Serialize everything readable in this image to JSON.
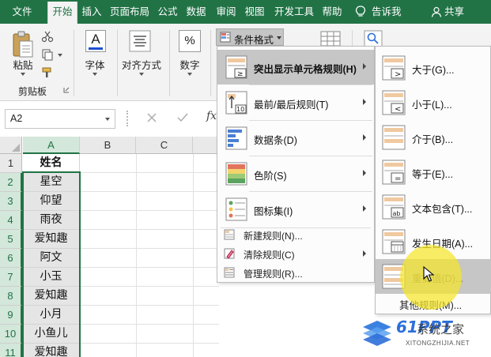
{
  "colors": {
    "tabbar": "#217346",
    "selection": "#217346",
    "menu_hover": "#c6c6c6",
    "spotlight": "#f5e628"
  },
  "tabs": [
    "文件",
    "开始",
    "插入",
    "页面布局",
    "公式",
    "数据",
    "审阅",
    "视图",
    "开发工具",
    "帮助",
    "告诉我",
    "共享"
  ],
  "active_tab": "开始",
  "ribbon": {
    "paste_label": "粘贴",
    "clipboard_group": "剪贴板",
    "font_label": "字体",
    "align_label": "对齐方式",
    "number_label": "数字",
    "number_icon": "%",
    "font_icon": "A",
    "cf_button_label": "条件格式"
  },
  "name_box": "A2",
  "formula_fx": "fx",
  "columns": [
    "A",
    "B",
    "C"
  ],
  "selected_column": "A",
  "rows": [
    {
      "num": "1",
      "value": "姓名"
    },
    {
      "num": "2",
      "value": "星空"
    },
    {
      "num": "3",
      "value": "仰望"
    },
    {
      "num": "4",
      "value": "雨夜"
    },
    {
      "num": "5",
      "value": "爱知趣"
    },
    {
      "num": "6",
      "value": "阿文"
    },
    {
      "num": "7",
      "value": "小玉"
    },
    {
      "num": "8",
      "value": "爱知趣"
    },
    {
      "num": "9",
      "value": "小月"
    },
    {
      "num": "10",
      "value": "小鱼儿"
    },
    {
      "num": "11",
      "value": "爱知趣"
    }
  ],
  "cf_menu": {
    "items": [
      {
        "label": "突出显示单元格规则(H)",
        "icon": "highlight-cells-rules-icon"
      },
      {
        "label": "最前/最后规则(T)",
        "icon": "top-bottom-rules-icon"
      },
      {
        "label": "数据条(D)",
        "icon": "data-bars-icon"
      },
      {
        "label": "色阶(S)",
        "icon": "color-scales-icon"
      },
      {
        "label": "图标集(I)",
        "icon": "icon-sets-icon"
      }
    ],
    "small_items": [
      {
        "label": "新建规则(N)...",
        "icon": "new-rule-icon"
      },
      {
        "label": "清除规则(C)",
        "icon": "clear-rules-icon"
      },
      {
        "label": "管理规则(R)...",
        "icon": "manage-rules-icon"
      }
    ]
  },
  "highlight_submenu": {
    "items": [
      {
        "label": "大于(G)...",
        "icon": "greater-than-icon",
        "glyph": ">"
      },
      {
        "label": "小于(L)...",
        "icon": "less-than-icon",
        "glyph": "<"
      },
      {
        "label": "介于(B)...",
        "icon": "between-icon",
        "glyph": ""
      },
      {
        "label": "等于(E)...",
        "icon": "equal-to-icon",
        "glyph": "="
      },
      {
        "label": "文本包含(T)...",
        "icon": "text-contains-icon",
        "glyph": "ab"
      },
      {
        "label": "发生日期(A)...",
        "icon": "date-occurring-icon",
        "glyph": ""
      },
      {
        "label": "重复值(D)...",
        "icon": "duplicate-values-icon",
        "glyph": ""
      }
    ],
    "other_rules": "其他规则(M)..."
  },
  "watermark": {
    "brand": "61PPT",
    "site": "XITONGZHIJIA.NET",
    "text": "系统之家"
  }
}
